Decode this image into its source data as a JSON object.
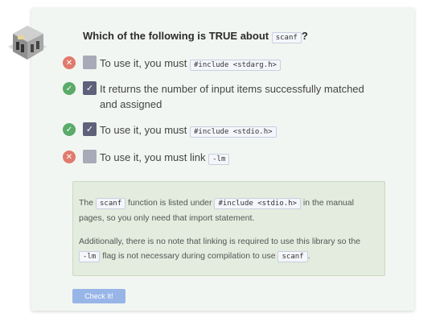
{
  "question": {
    "prefix": "Which of the following is TRUE about",
    "code": "scanf",
    "suffix": "?"
  },
  "options": [
    {
      "status": "wrong",
      "checked": false,
      "text": "To use it, you must",
      "code": "#include <stdarg.h>",
      "code_after": ""
    },
    {
      "status": "right",
      "checked": true,
      "text": "It returns the number of input items successfully matched and assigned",
      "code": "",
      "code_after": ""
    },
    {
      "status": "right",
      "checked": true,
      "text": "To use it, you must",
      "code": "#include <stdio.h>",
      "code_after": ""
    },
    {
      "status": "wrong",
      "checked": false,
      "text": "To use it, you must link",
      "code": "-lm",
      "code_after": ""
    }
  ],
  "explanation": {
    "p1": {
      "t1": "The",
      "c1": "scanf",
      "t2": "function is listed under",
      "c2": "#include <stdio.h>",
      "t3": "in the manual pages, so you only need that import statement."
    },
    "p2": {
      "t1": "Additionally, there is no note that linking is required to use this library so the",
      "c1": "-lm",
      "t2": "flag is not necessary during compilation to use",
      "c2": "scanf",
      "t3": "."
    }
  },
  "button": {
    "label": "Check It!"
  },
  "icons": {
    "wrong": "x-circle-icon",
    "right": "check-circle-icon",
    "checkbox_checked": "checkmark-icon"
  },
  "colors": {
    "wrong": "#e07a6e",
    "right": "#5aab6a",
    "checked_box": "#5f6079",
    "unchecked_box": "#a8aab8",
    "explanation_bg": "#e3ecde",
    "button_bg": "#98b5e8"
  }
}
